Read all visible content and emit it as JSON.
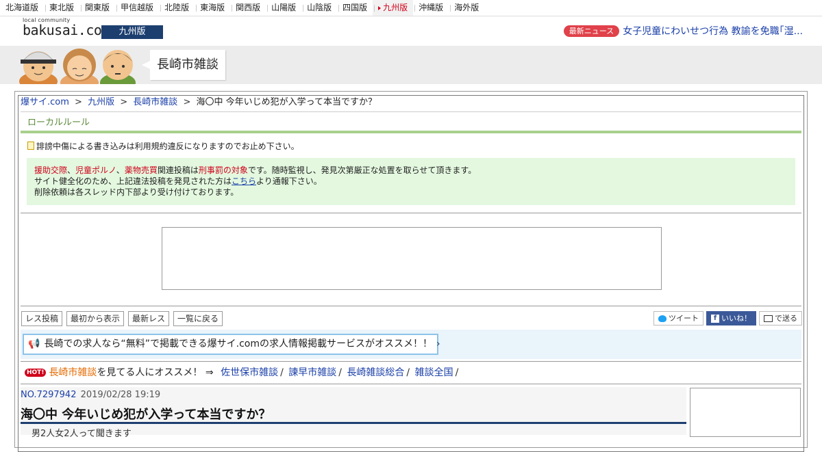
{
  "regions": [
    "北海道版",
    "東北版",
    "関東版",
    "甲信越版",
    "北陸版",
    "東海版",
    "関西版",
    "山陽版",
    "山陰版",
    "四国版",
    "九州版",
    "沖縄版",
    "海外版"
  ],
  "active_region": "九州版",
  "logo": {
    "small": "local community",
    "main": "bakusai.com"
  },
  "edition_label": "九州版",
  "news": {
    "badge": "最新ニュース",
    "headline": "女子児童にわいせつ行為 教諭を免職｢湿..."
  },
  "board_title": "長崎市雑談",
  "breadcrumb": {
    "home": "爆サイ.com",
    "sep": ">",
    "region": "九州版",
    "board": "長崎市雑談",
    "thread": "海〇中 今年いじめ犯が入学って本当ですか？"
  },
  "local_rule": {
    "title": "ローカルルール",
    "notice": "誹謗中傷による書き込みは利用規約違反になりますのでお止め下さい。",
    "line1": {
      "t1": "援助交際",
      "c1": "、",
      "t2": "児童ポルノ",
      "c2": "、",
      "t3": "薬物売買",
      "mid": "関連投稿は",
      "t4": "刑事罰の対象",
      "end": "です。随時監視し、発見次第厳正な処置を取らせて頂きます。"
    },
    "line2": {
      "pre": "サイト健全化のため、上記違法投稿を発見された方は",
      "link": "こちら",
      "post": "より通報下さい。"
    },
    "line3": "削除依頼は各スレッド内下部より受け付けております。"
  },
  "buttons": {
    "post": "レス投稿",
    "from_start": "最初から表示",
    "latest": "最新レス",
    "back": "一覧に戻る"
  },
  "share": {
    "tweet": "ツイート",
    "like": "いいね！",
    "send": "で送る"
  },
  "job_banner": "長崎での求人なら“無料”で掲載できる爆サイ.comの求人情報掲載サービスがオススメ！！",
  "recommend": {
    "hot": "HOT!",
    "board": "長崎市雑談",
    "text": "を見てる人にオススメ！ ⇒",
    "links": [
      "佐世保市雑談",
      "諫早市雑談",
      "長崎雑談総合",
      "雑談全国"
    ],
    "slash": "/"
  },
  "post": {
    "no": "NO.7297942",
    "date": "2019/02/28 19:19",
    "title": "海〇中 今年いじめ犯が入学って本当ですか？",
    "body": "男2人女2人って聞きます"
  }
}
